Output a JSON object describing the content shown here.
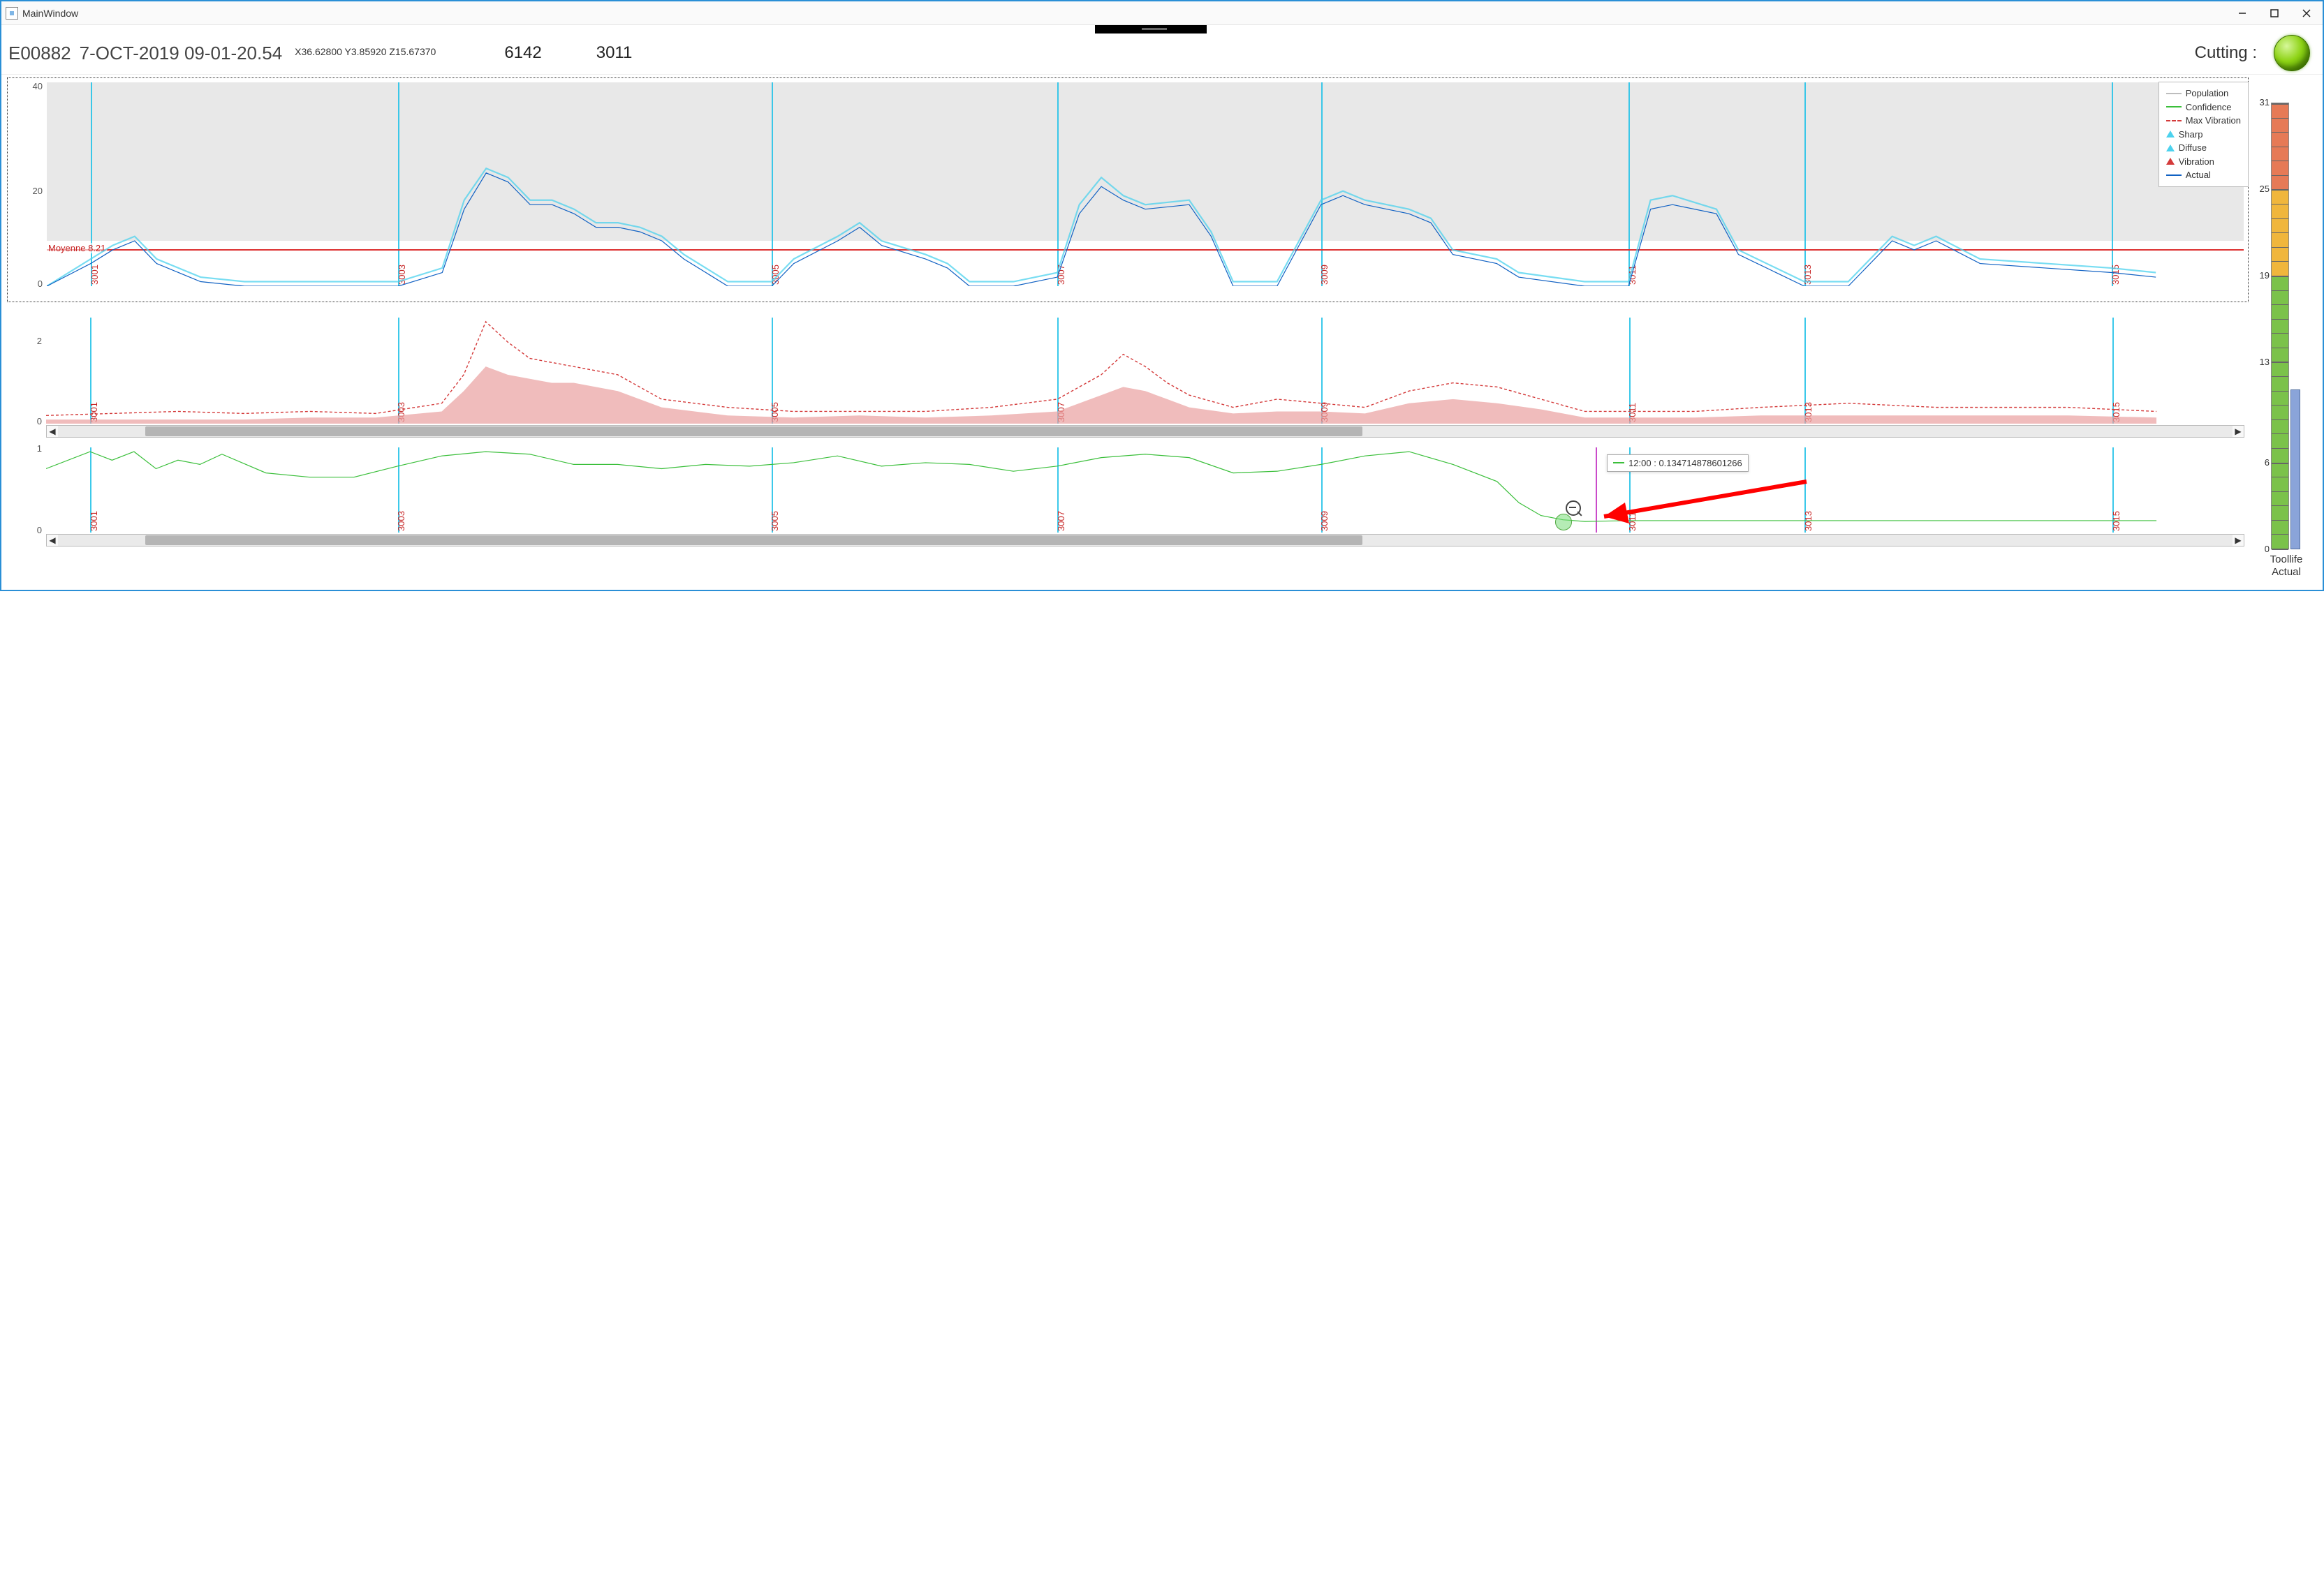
{
  "window": {
    "title": "MainWindow"
  },
  "header": {
    "eid": "E00882",
    "timestamp": "7-OCT-2019 09-01-20.54",
    "coords": "X36.62800 Y3.85920 Z15.67370",
    "value_a": "6142",
    "value_b": "3011",
    "status_label": "Cutting :",
    "status_color": "#7bc410"
  },
  "legend": {
    "items": [
      {
        "label": "Population",
        "kind": "line",
        "color": "#bdbdbd"
      },
      {
        "label": "Confidence",
        "kind": "line",
        "color": "#3bbf3b"
      },
      {
        "label": "Max Vibration",
        "kind": "dash",
        "color": "#d43a3a"
      },
      {
        "label": "Sharp",
        "kind": "tri",
        "color": "#4cd2ee"
      },
      {
        "label": "Diffuse",
        "kind": "tri",
        "color": "#4cd2ee"
      },
      {
        "label": "Vibration",
        "kind": "tri",
        "color": "#d43a3a"
      },
      {
        "label": "Actual",
        "kind": "line",
        "color": "#1061c3"
      }
    ]
  },
  "markers": [
    "3001",
    "3003",
    "3005",
    "3007",
    "3009",
    "3011",
    "3013",
    "3015"
  ],
  "marker_x_pct": [
    2,
    16,
    33,
    46,
    58,
    72,
    80,
    94
  ],
  "chart_data": [
    {
      "id": "top",
      "type": "line",
      "title": "",
      "xlabel": "",
      "ylabel": "",
      "ylim": [
        0,
        45
      ],
      "yticks": [
        0,
        20,
        40
      ],
      "avg_label": "Moyenne",
      "avg_value": 8.21,
      "shade_y": [
        10,
        45
      ],
      "series": [
        {
          "name": "Actual",
          "color": "#1061c3",
          "x": [
            0,
            2,
            3,
            4,
            5,
            7,
            9,
            12,
            14,
            16,
            18,
            19,
            20,
            21,
            22,
            23,
            24,
            25,
            26,
            27,
            28,
            29,
            30,
            31,
            33,
            34,
            36,
            37,
            38,
            40,
            41,
            42,
            44,
            46,
            47,
            48,
            49,
            50,
            52,
            53,
            54,
            56,
            58,
            59,
            60,
            62,
            63,
            64,
            66,
            67,
            70,
            72,
            73,
            74,
            76,
            77,
            80,
            82,
            84,
            85,
            86,
            88,
            94,
            96
          ],
          "y": [
            0,
            5,
            8,
            10,
            5,
            1,
            0,
            0,
            0,
            0,
            3,
            17,
            25,
            23,
            18,
            18,
            16,
            13,
            13,
            12,
            10,
            6,
            3,
            0,
            0,
            5,
            10,
            13,
            9,
            6,
            4,
            0,
            0,
            2,
            16,
            22,
            19,
            17,
            18,
            11,
            0,
            0,
            18,
            20,
            18,
            16,
            14,
            7,
            5,
            2,
            0,
            0,
            17,
            18,
            16,
            7,
            0,
            0,
            10,
            8,
            10,
            5,
            3,
            2
          ]
        },
        {
          "name": "Diffuse",
          "color": "#4cd2ee",
          "x": [
            0,
            2,
            3,
            4,
            5,
            7,
            9,
            12,
            14,
            16,
            18,
            19,
            20,
            21,
            22,
            23,
            24,
            25,
            26,
            27,
            28,
            29,
            30,
            31,
            33,
            34,
            36,
            37,
            38,
            40,
            41,
            42,
            44,
            46,
            47,
            48,
            49,
            50,
            52,
            53,
            54,
            56,
            58,
            59,
            60,
            62,
            63,
            64,
            66,
            67,
            70,
            72,
            73,
            74,
            76,
            77,
            80,
            82,
            84,
            85,
            86,
            88,
            94,
            96
          ],
          "y": [
            0,
            6,
            9,
            11,
            6,
            2,
            1,
            1,
            1,
            1,
            4,
            19,
            26,
            24,
            19,
            19,
            17,
            14,
            14,
            13,
            11,
            7,
            4,
            1,
            1,
            6,
            11,
            14,
            10,
            7,
            5,
            1,
            1,
            3,
            18,
            24,
            20,
            18,
            19,
            12,
            1,
            1,
            19,
            21,
            19,
            17,
            15,
            8,
            6,
            3,
            1,
            1,
            19,
            20,
            17,
            8,
            1,
            1,
            11,
            9,
            11,
            6,
            4,
            3
          ]
        }
      ]
    },
    {
      "id": "mid",
      "type": "area",
      "title": "",
      "ylim": [
        0,
        2.6
      ],
      "yticks": [
        0,
        2
      ],
      "scroll_thumb": [
        4,
        60
      ],
      "series": [
        {
          "name": "Max Vibration",
          "style": "dash",
          "color": "#d43a3a",
          "x": [
            0,
            3,
            6,
            9,
            12,
            15,
            18,
            19,
            20,
            21,
            22,
            23,
            24,
            26,
            28,
            31,
            34,
            37,
            40,
            43,
            46,
            48,
            49,
            50,
            51,
            52,
            54,
            56,
            58,
            60,
            62,
            64,
            66,
            68,
            70,
            72,
            75,
            78,
            82,
            86,
            88,
            92,
            96
          ],
          "y": [
            0.2,
            0.25,
            0.3,
            0.25,
            0.3,
            0.25,
            0.5,
            1.2,
            2.5,
            2.0,
            1.6,
            1.5,
            1.4,
            1.2,
            0.6,
            0.4,
            0.3,
            0.3,
            0.3,
            0.4,
            0.6,
            1.2,
            1.7,
            1.4,
            1.0,
            0.7,
            0.4,
            0.6,
            0.5,
            0.4,
            0.8,
            1.0,
            0.9,
            0.6,
            0.3,
            0.3,
            0.3,
            0.4,
            0.5,
            0.4,
            0.4,
            0.4,
            0.3
          ]
        },
        {
          "name": "Vibration",
          "style": "area",
          "color": "#d88",
          "x": [
            0,
            3,
            6,
            9,
            12,
            15,
            18,
            19,
            20,
            21,
            22,
            23,
            24,
            26,
            28,
            31,
            34,
            37,
            40,
            43,
            46,
            48,
            49,
            50,
            51,
            52,
            54,
            56,
            58,
            60,
            62,
            64,
            66,
            68,
            70,
            72,
            75,
            78,
            82,
            86,
            88,
            92,
            96
          ],
          "y": [
            0.1,
            0.1,
            0.1,
            0.1,
            0.15,
            0.15,
            0.3,
            0.8,
            1.4,
            1.2,
            1.1,
            1.0,
            1.0,
            0.8,
            0.4,
            0.2,
            0.15,
            0.2,
            0.15,
            0.2,
            0.3,
            0.7,
            0.9,
            0.8,
            0.6,
            0.4,
            0.25,
            0.3,
            0.3,
            0.25,
            0.5,
            0.6,
            0.5,
            0.35,
            0.15,
            0.15,
            0.15,
            0.2,
            0.2,
            0.2,
            0.2,
            0.2,
            0.15
          ]
        }
      ]
    },
    {
      "id": "bot",
      "type": "line",
      "title": "",
      "ylim": [
        0,
        1
      ],
      "yticks": [
        0,
        1
      ],
      "tooltip": {
        "label": "12:00 : 0.134714878601266",
        "x_pct": 71
      },
      "cursor_x_pct": 70.5,
      "hover_x_pct": 69,
      "hover_y": 0.13,
      "scroll_thumb": [
        4,
        60
      ],
      "series": [
        {
          "name": "Confidence",
          "color": "#3bbf3b",
          "x": [
            0,
            2,
            3,
            4,
            5,
            6,
            7,
            8,
            10,
            12,
            14,
            16,
            18,
            20,
            22,
            24,
            26,
            28,
            30,
            32,
            34,
            36,
            38,
            40,
            42,
            44,
            46,
            48,
            50,
            52,
            54,
            56,
            58,
            60,
            62,
            64,
            66,
            67,
            68,
            69,
            70,
            72,
            96
          ],
          "y": [
            0.75,
            0.95,
            0.85,
            0.95,
            0.75,
            0.85,
            0.8,
            0.92,
            0.7,
            0.65,
            0.65,
            0.78,
            0.9,
            0.95,
            0.92,
            0.8,
            0.8,
            0.75,
            0.8,
            0.78,
            0.82,
            0.9,
            0.78,
            0.82,
            0.8,
            0.72,
            0.78,
            0.88,
            0.92,
            0.88,
            0.7,
            0.72,
            0.8,
            0.9,
            0.95,
            0.8,
            0.6,
            0.35,
            0.2,
            0.15,
            0.13,
            0.14,
            0.14
          ]
        }
      ]
    }
  ],
  "gauge": {
    "ticks": [
      0,
      6,
      13,
      19,
      25,
      31
    ],
    "range": [
      0,
      31
    ],
    "segments": [
      {
        "from": 0,
        "to": 19,
        "color": "#7bc24a"
      },
      {
        "from": 19,
        "to": 25,
        "color": "#f0b63c"
      },
      {
        "from": 25,
        "to": 31,
        "color": "#e67a56"
      }
    ],
    "actual_value": 11,
    "caption_line1": "Toollife",
    "caption_line2": "Actual"
  }
}
